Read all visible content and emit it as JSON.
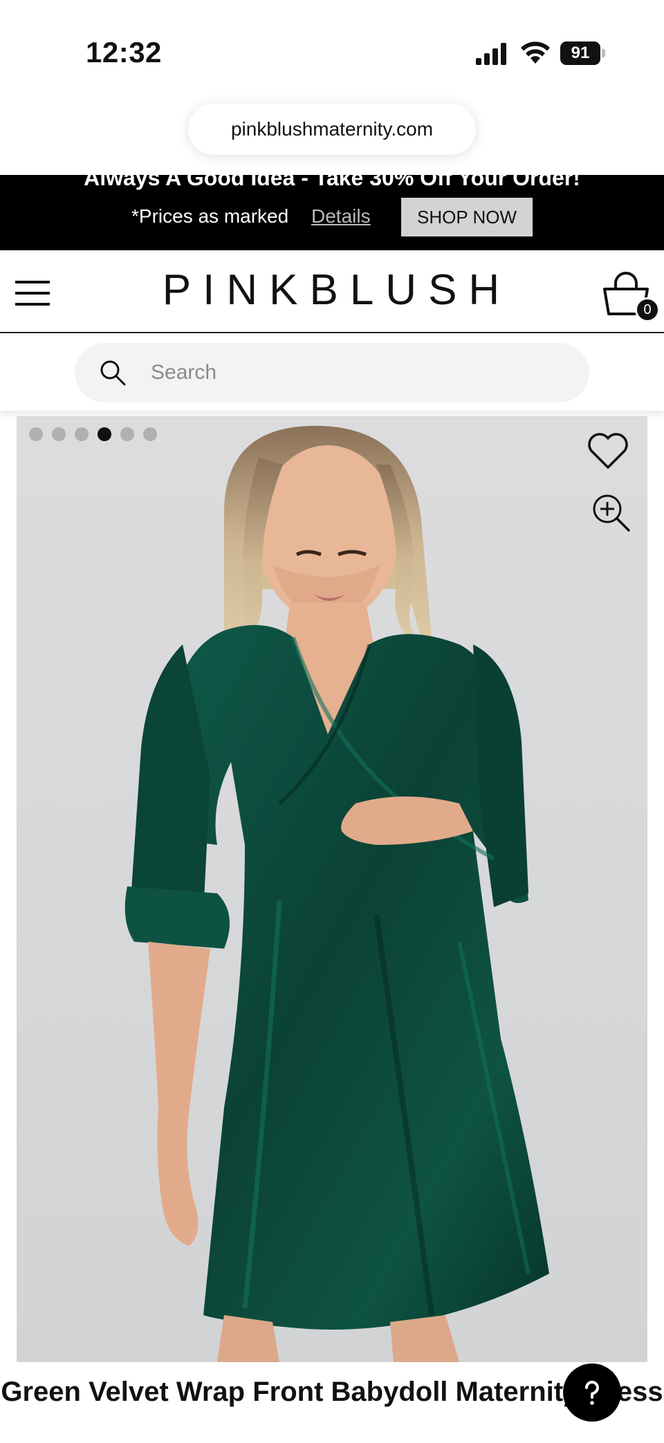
{
  "status_bar": {
    "time": "12:32",
    "battery": "91",
    "icons": [
      "signal-icon",
      "wifi-icon",
      "battery-icon"
    ]
  },
  "browser": {
    "url": "pinkblushmaternity.com"
  },
  "promo": {
    "headline": "Always A Good Idea - Take 30% Off Your Order!",
    "note": "*Prices as marked",
    "details_link": "Details",
    "shop_button": "SHOP NOW"
  },
  "header": {
    "logo": "PINKBLUSH",
    "cart_count": "0",
    "icons": [
      "menu-icon",
      "cart-icon"
    ]
  },
  "search": {
    "placeholder": "Search"
  },
  "product": {
    "image_count": 6,
    "active_image": 4,
    "title": "Green Velvet Wrap Front Babydoll Maternity Dress",
    "icons": [
      "heart-icon",
      "zoom-icon",
      "help-icon"
    ]
  },
  "colors": {
    "promo_bg": "#000000",
    "dress": "#0c4a3c",
    "image_bg": "#d8d9db"
  }
}
